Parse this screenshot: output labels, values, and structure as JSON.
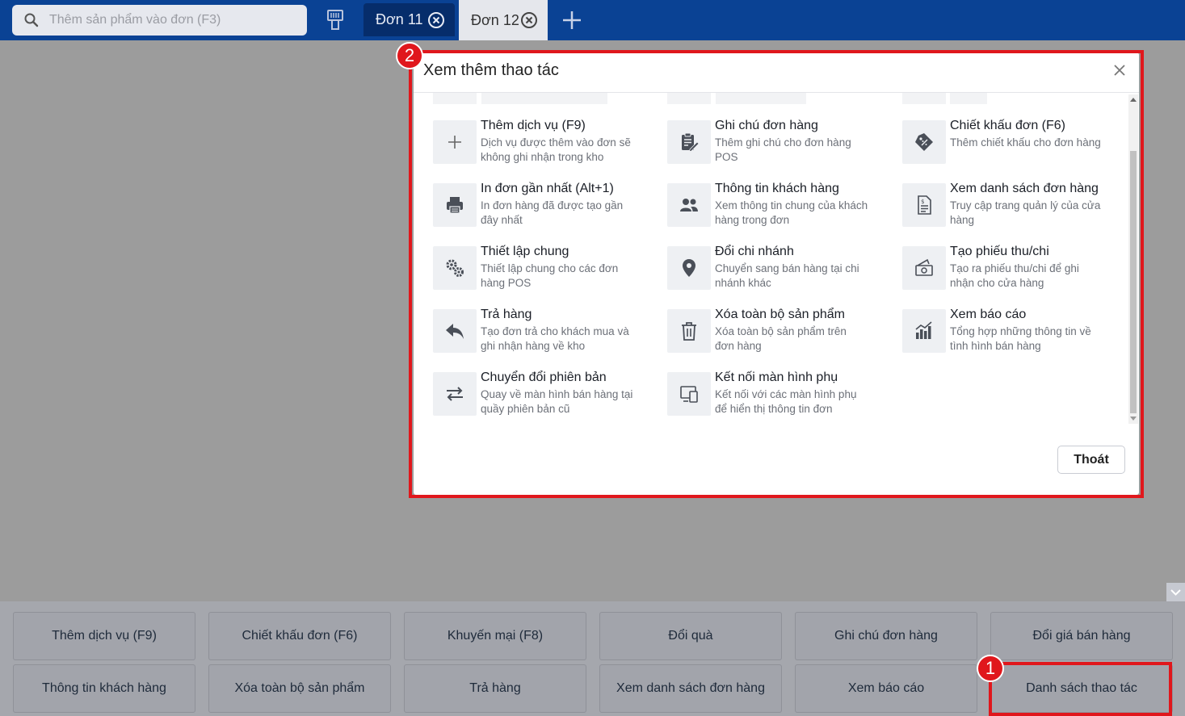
{
  "topbar": {
    "search_placeholder": "Thêm sản phẩm vào đơn (F3)",
    "tabs": [
      {
        "label": "Đơn 11"
      },
      {
        "label": "Đơn 12"
      }
    ]
  },
  "modal": {
    "title": "Xem thêm thao tác",
    "exit_label": "Thoát",
    "items": [
      {
        "title": "Thêm dịch vụ (F9)",
        "desc": "Dịch vụ được thêm vào đơn sẽ không ghi nhận trong kho",
        "icon": "plus-icon"
      },
      {
        "title": "Ghi chú đơn hàng",
        "desc": "Thêm ghi chú cho đơn hàng POS",
        "icon": "note-icon"
      },
      {
        "title": "Chiết khấu đơn (F6)",
        "desc": "Thêm chiết khấu cho đơn hàng",
        "icon": "discount-tag-icon"
      },
      {
        "title": "In đơn gần nhất (Alt+1)",
        "desc": "In đơn hàng đã được tạo gần đây nhất",
        "icon": "printer-icon"
      },
      {
        "title": "Thông tin khách hàng",
        "desc": "Xem thông tin chung của khách hàng trong đơn",
        "icon": "customers-icon"
      },
      {
        "title": "Xem danh sách đơn hàng",
        "desc": "Truy cập trang quản lý của cửa hàng",
        "icon": "order-list-icon"
      },
      {
        "title": "Thiết lập chung",
        "desc": "Thiết lập chung cho các đơn hàng POS",
        "icon": "gears-icon"
      },
      {
        "title": "Đổi chi nhánh",
        "desc": "Chuyển sang bán hàng tại chi nhánh khác",
        "icon": "location-pin-icon"
      },
      {
        "title": "Tạo phiếu thu/chi",
        "desc": "Tạo ra phiếu thu/chi để ghi nhận cho cửa hàng",
        "icon": "cash-voucher-icon"
      },
      {
        "title": "Trả hàng",
        "desc": "Tạo đơn trả cho khách mua và ghi nhận hàng về kho",
        "icon": "return-arrow-icon"
      },
      {
        "title": "Xóa toàn bộ sản phẩm",
        "desc": "Xóa toàn bộ sản phẩm trên đơn hàng",
        "icon": "trash-icon"
      },
      {
        "title": "Xem báo cáo",
        "desc": "Tổng hợp những thông tin về tình hình bán hàng",
        "icon": "report-chart-icon"
      },
      {
        "title": "Chuyển đổi phiên bản",
        "desc": "Quay về màn hình bán hàng tại quầy phiên bản cũ",
        "icon": "swap-arrows-icon"
      },
      {
        "title": "Kết nối màn hình phụ",
        "desc": "Kết nối với các màn hình phụ để hiển thị thông tin đơn",
        "icon": "second-screen-icon"
      }
    ]
  },
  "actions": [
    "Thêm dịch vụ (F9)",
    "Chiết khấu đơn (F6)",
    "Khuyến mại (F8)",
    "Đổi quà",
    "Ghi chú đơn hàng",
    "Đổi giá bán hàng",
    "Thông tin khách hàng",
    "Xóa toàn bộ sản phẩm",
    "Trả hàng",
    "Xem danh sách đơn hàng",
    "Xem báo cáo",
    "Danh sách thao tác"
  ],
  "annotations": {
    "badge1": "1",
    "badge2": "2",
    "color": "#e0171c"
  },
  "colors": {
    "topbar": "#0a4294",
    "active_tab": "#062d6b",
    "overlay": "#9c9c9c"
  }
}
